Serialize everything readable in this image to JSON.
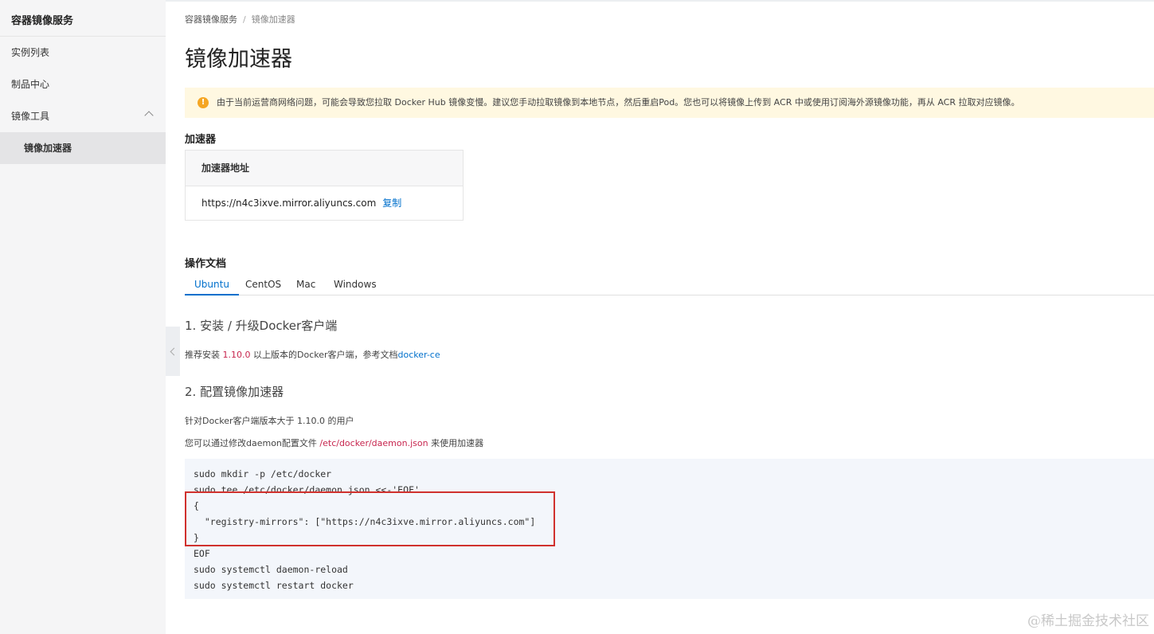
{
  "sidebar": {
    "title": "容器镜像服务",
    "items": [
      {
        "label": "实例列表"
      },
      {
        "label": "制品中心"
      },
      {
        "label": "镜像工具"
      },
      {
        "label": "镜像加速器"
      }
    ]
  },
  "breadcrumb": {
    "root": "容器镜像服务",
    "sep": "/",
    "current": "镜像加速器"
  },
  "page_title": "镜像加速器",
  "notice": {
    "icon": "!",
    "text": "由于当前运营商网络问题，可能会导致您拉取 Docker Hub 镜像变慢。建议您手动拉取镜像到本地节点，然后重启Pod。您也可以将镜像上传到 ACR 中或使用订阅海外源镜像功能，再从 ACR 拉取对应镜像。"
  },
  "accelerator": {
    "section": "加速器",
    "header": "加速器地址",
    "url": "https://n4c3ixve.mirror.aliyuncs.com",
    "copy": "复制"
  },
  "docs": {
    "section": "操作文档",
    "tabs": [
      "Ubuntu",
      "CentOS",
      "Mac",
      "Windows"
    ],
    "step1_title": "1. 安装 / 升级Docker客户端",
    "step1_text_a": "推荐安装 ",
    "step1_version": "1.10.0",
    "step1_text_b": " 以上版本的Docker客户端，参考文档",
    "step1_link": "docker-ce",
    "step2_title": "2. 配置镜像加速器",
    "step2_text1": "针对Docker客户端版本大于 1.10.0 的用户",
    "step2_text2_a": "您可以通过修改daemon配置文件 ",
    "step2_path": "/etc/docker/daemon.json",
    "step2_text2_b": " 来使用加速器",
    "code_lines": [
      "sudo mkdir -p /etc/docker",
      "sudo tee /etc/docker/daemon.json <<-'EOF'",
      "{",
      "  \"registry-mirrors\": [\"https://n4c3ixve.mirror.aliyuncs.com\"]",
      "}",
      "EOF",
      "sudo systemctl daemon-reload",
      "sudo systemctl restart docker"
    ]
  },
  "watermark": "@稀土掘金技术社区",
  "colors": {
    "accent": "#0070cc",
    "highlight": "#d0312d",
    "warning": "#f5a623"
  }
}
